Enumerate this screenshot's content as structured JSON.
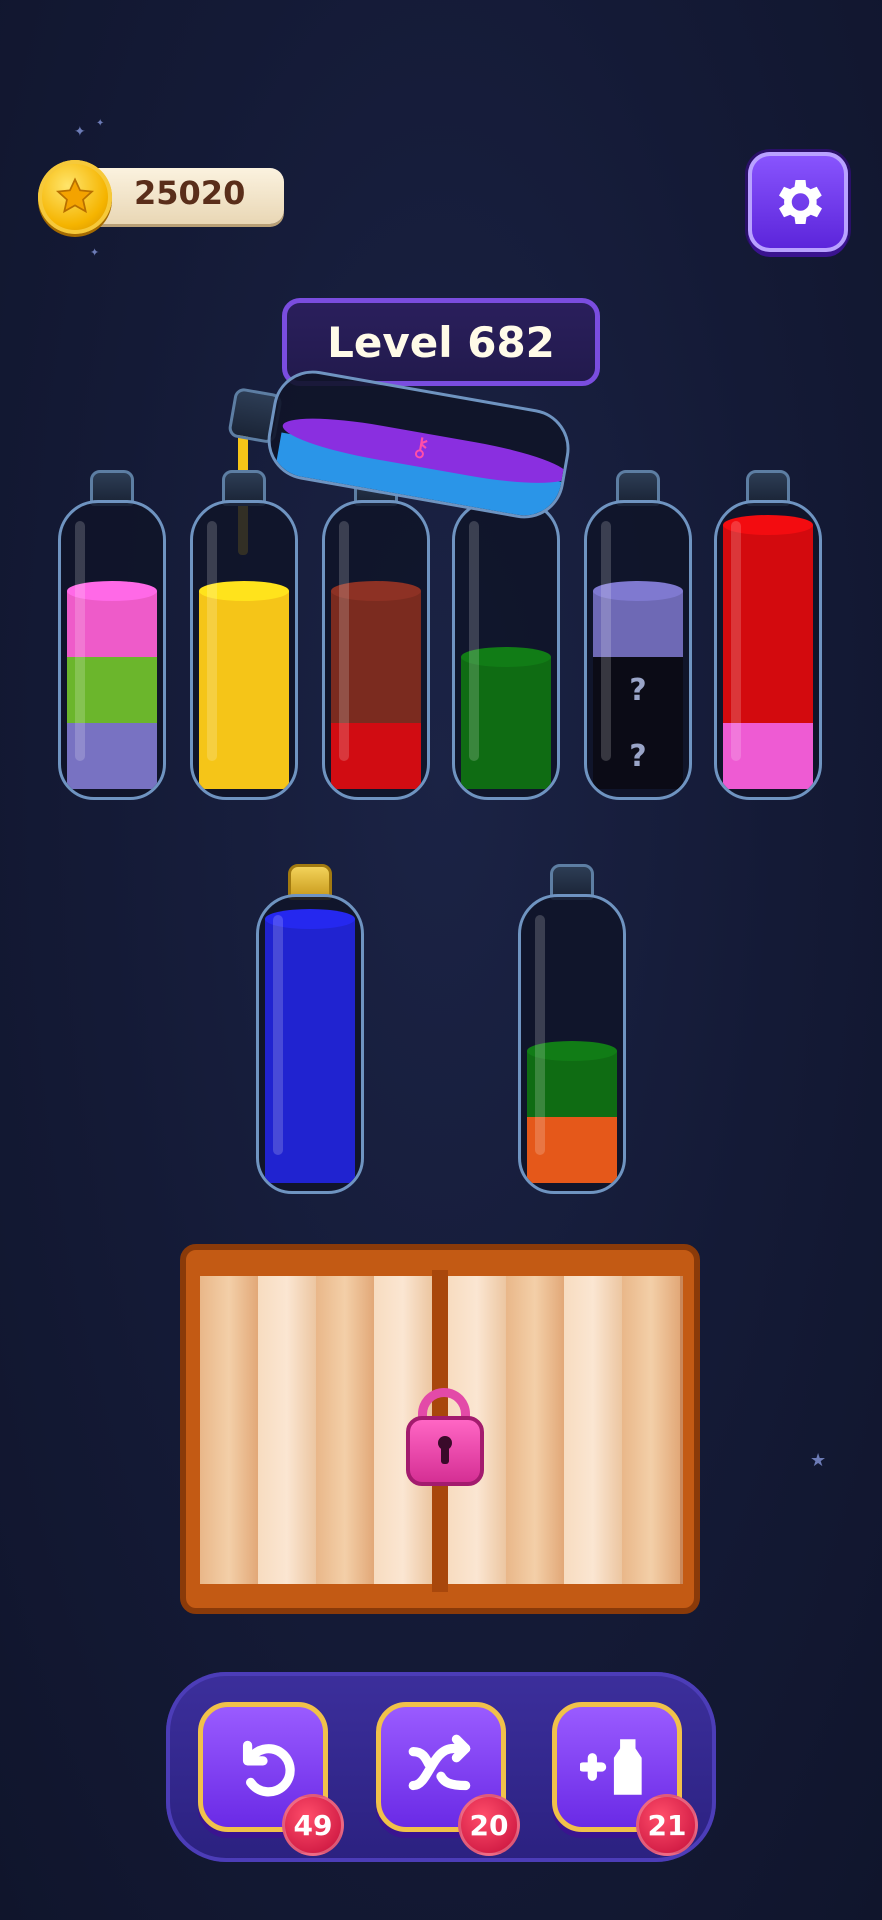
{
  "header": {
    "coins": "25020",
    "coin_icon": "star-coin-icon",
    "settings_icon": "gear-icon"
  },
  "level": {
    "label": "Level 682"
  },
  "bottles_row1": [
    {
      "layers": [
        "#7872c2",
        "#6bb62c",
        "#ee5bc9"
      ]
    },
    {
      "layers": [
        "#f5c518",
        "#f5c518",
        "#f5c518"
      ]
    },
    {
      "layers": [
        "#d10c12",
        "#7b2b1f",
        "#7b2b1f"
      ]
    },
    {
      "layers": [
        "#0f6c13",
        "#0f6c13"
      ]
    },
    {
      "layers": [
        "hidden",
        "hidden",
        "#6e69b5"
      ],
      "hidden_marker": "?"
    },
    {
      "layers": [
        "#ee5bd3",
        "#d30a0e",
        "#d30a0e",
        "#d30a0e"
      ]
    }
  ],
  "bottles_row2": [
    {
      "layers": [
        "#2023d0",
        "#2023d0",
        "#2023d0",
        "#2023d0"
      ],
      "corked": true
    },
    {
      "layers": [
        "#e5581a",
        "#0f6c13"
      ]
    }
  ],
  "pouring_bottle": {
    "layers": [
      "#2a95e8",
      "#8a2fe0"
    ],
    "key_icon": "key-icon"
  },
  "locked_box": {
    "lock_icon": "padlock-icon"
  },
  "tools": [
    {
      "icon": "undo-icon",
      "count": "49"
    },
    {
      "icon": "shuffle-icon",
      "count": "20"
    },
    {
      "icon": "add-bottle-icon",
      "count": "21"
    }
  ]
}
